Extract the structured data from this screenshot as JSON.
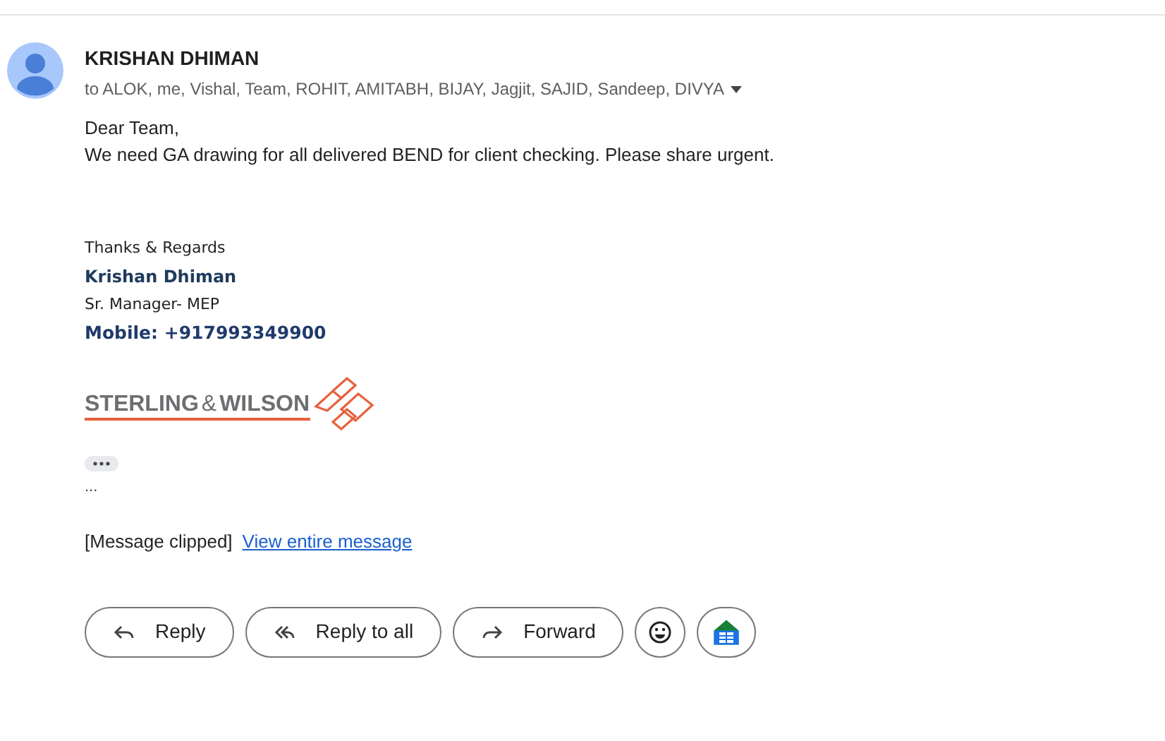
{
  "sender": {
    "name": "KRISHAN DHIMAN",
    "recipients": "to ALOK, me, Vishal, Team, ROHIT, AMITABH, BIJAY, Jagjit, SAJID, Sandeep, DIVYA"
  },
  "body": {
    "greeting": "Dear Team,",
    "message": "We need GA drawing for all delivered BEND for client checking. Please share urgent."
  },
  "signature": {
    "closing": "Thanks & Regards",
    "name": "Krishan Dhiman",
    "title": "Sr. Manager- MEP",
    "mobile": "Mobile: +917993349900",
    "logo_left": "STERLING",
    "logo_amp": "&",
    "logo_right": "WILSON"
  },
  "ellipsis": "...",
  "clipped": {
    "notice": "[Message clipped]",
    "link": "View entire message"
  },
  "actions": [
    {
      "kind": "reply",
      "label": "Reply"
    },
    {
      "kind": "reply_all",
      "label": "Reply to all"
    },
    {
      "kind": "forward",
      "label": "Forward"
    },
    {
      "kind": "emoji"
    },
    {
      "kind": "sheets"
    }
  ]
}
